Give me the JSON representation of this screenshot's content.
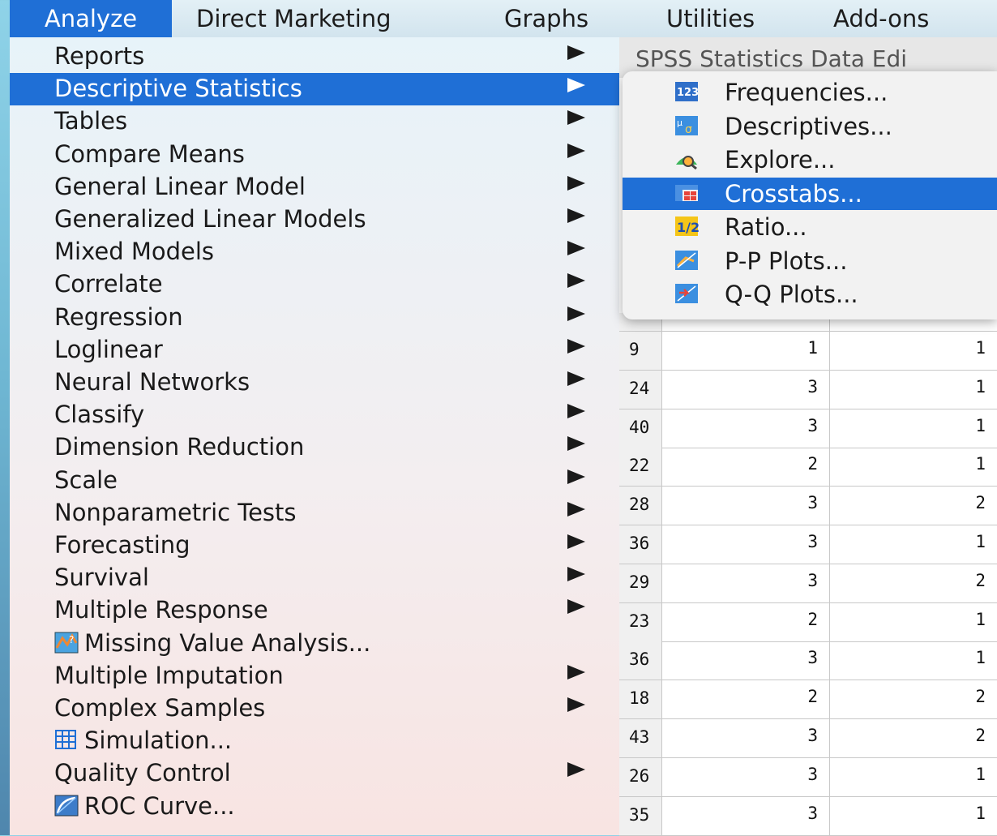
{
  "menubar": {
    "items": [
      {
        "label": "Analyze",
        "active": true
      },
      {
        "label": "Direct Marketing"
      },
      {
        "label": "Graphs"
      },
      {
        "label": "Utilities"
      },
      {
        "label": "Add-ons"
      }
    ]
  },
  "analyze_menu": {
    "items": [
      {
        "label": "Reports",
        "submenu": true
      },
      {
        "label": "Descriptive Statistics",
        "submenu": true,
        "highlighted": true
      },
      {
        "label": "Tables",
        "submenu": true
      },
      {
        "label": "Compare Means",
        "submenu": true
      },
      {
        "label": "General Linear Model",
        "submenu": true
      },
      {
        "label": "Generalized Linear Models",
        "submenu": true
      },
      {
        "label": "Mixed Models",
        "submenu": true
      },
      {
        "label": "Correlate",
        "submenu": true
      },
      {
        "label": "Regression",
        "submenu": true
      },
      {
        "label": "Loglinear",
        "submenu": true
      },
      {
        "label": "Neural Networks",
        "submenu": true
      },
      {
        "label": "Classify",
        "submenu": true
      },
      {
        "label": "Dimension Reduction",
        "submenu": true
      },
      {
        "label": "Scale",
        "submenu": true
      },
      {
        "label": "Nonparametric Tests",
        "submenu": true
      },
      {
        "label": "Forecasting",
        "submenu": true
      },
      {
        "label": "Survival",
        "submenu": true
      },
      {
        "label": "Multiple Response",
        "submenu": true
      },
      {
        "label": "Missing Value Analysis...",
        "icon": "missing-value-analysis-icon"
      },
      {
        "label": "Multiple Imputation",
        "submenu": true
      },
      {
        "label": "Complex Samples",
        "submenu": true
      },
      {
        "label": "Simulation...",
        "icon": "simulation-icon"
      },
      {
        "label": "Quality Control",
        "submenu": true
      },
      {
        "label": "ROC Curve...",
        "icon": "roc-curve-icon"
      }
    ]
  },
  "descriptive_submenu": {
    "items": [
      {
        "label": "Frequencies...",
        "icon": "frequencies-icon"
      },
      {
        "label": "Descriptives...",
        "icon": "descriptives-icon"
      },
      {
        "label": "Explore...",
        "icon": "explore-icon"
      },
      {
        "label": "Crosstabs...",
        "icon": "crosstabs-icon",
        "highlighted": true
      },
      {
        "label": "Ratio...",
        "icon": "ratio-icon"
      },
      {
        "label": "P-P Plots...",
        "icon": "pp-plots-icon"
      },
      {
        "label": "Q-Q Plots...",
        "icon": "qq-plots-icon"
      }
    ]
  },
  "data_editor": {
    "title": "SPSS Statistics Data Edi",
    "rows": [
      [
        "9",
        "1",
        "1"
      ],
      [
        "24",
        "3",
        "1"
      ],
      [
        "40",
        "3",
        "1"
      ],
      [
        "22",
        "2",
        "1"
      ],
      [
        "28",
        "3",
        "2"
      ],
      [
        "36",
        "3",
        "1"
      ],
      [
        "29",
        "3",
        "2"
      ],
      [
        "23",
        "2",
        "1"
      ],
      [
        "36",
        "3",
        "1"
      ],
      [
        "18",
        "2",
        "2"
      ],
      [
        "43",
        "3",
        "2"
      ],
      [
        "26",
        "3",
        "1"
      ],
      [
        "35",
        "3",
        "1"
      ]
    ]
  },
  "colors": {
    "highlight": "#1f6fd6",
    "menubar_bg": "#d2e4ee"
  }
}
